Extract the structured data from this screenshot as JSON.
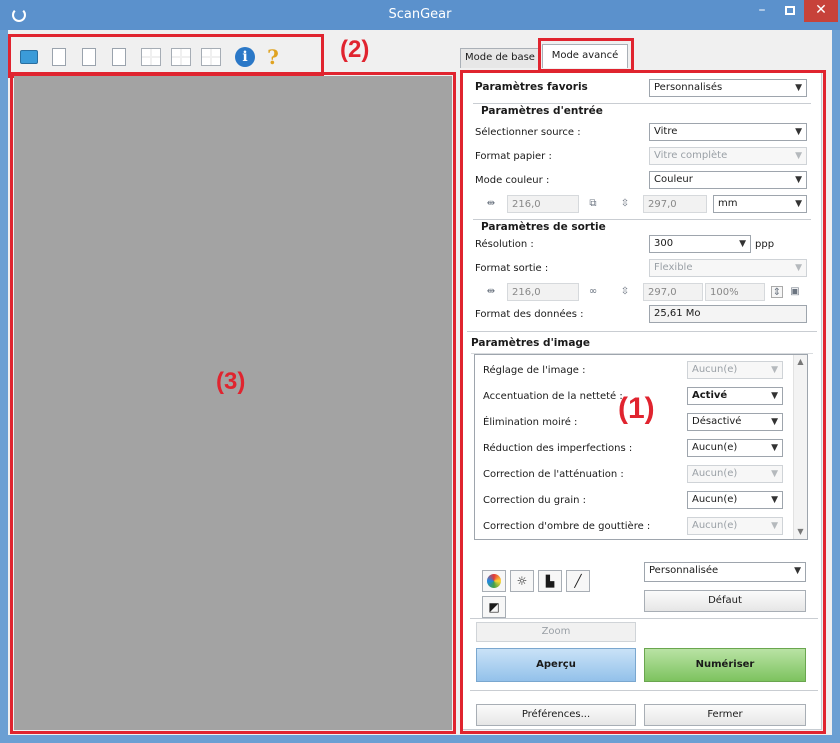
{
  "window": {
    "title": "ScanGear"
  },
  "toolbar": {
    "icons": [
      "scan-icon",
      "blank-page-icon",
      "zoom-image-icon",
      "crop-image-icon",
      "select-all-frames-icon",
      "multi-frame-icon",
      "frames-layout-icon",
      "info-icon",
      "help-icon"
    ]
  },
  "callouts": {
    "one": "(1)",
    "two": "(2)",
    "three": "(3)"
  },
  "tabs": {
    "basic": "Mode de base",
    "advanced": "Mode avancé"
  },
  "favorites": {
    "label": "Paramètres favoris",
    "value": "Personnalisés"
  },
  "input": {
    "title": "Paramètres d'entrée",
    "source_label": "Sélectionner source :",
    "source_value": "Vitre",
    "paper_label": "Format papier :",
    "paper_value": "Vitre complète",
    "color_label": "Mode couleur :",
    "color_value": "Couleur",
    "width": "216,0",
    "height": "297,0",
    "unit": "mm"
  },
  "output": {
    "title": "Paramètres de sortie",
    "res_label": "Résolution :",
    "res_value": "300",
    "res_unit": "ppp",
    "size_label": "Format sortie :",
    "size_value": "Flexible",
    "width": "216,0",
    "height": "297,0",
    "scale": "100%",
    "data_label": "Format des données :",
    "data_value": "25,61 Mo"
  },
  "image": {
    "title": "Paramètres d'image",
    "rows": [
      {
        "label": "Réglage de l'image :",
        "value": "Aucun(e)",
        "enabled": false
      },
      {
        "label": "Accentuation de la netteté :",
        "value": "Activé",
        "enabled": true,
        "bold": true
      },
      {
        "label": "Élimination moiré :",
        "value": "Désactivé",
        "enabled": true
      },
      {
        "label": "Réduction des imperfections :",
        "value": "Aucun(e)",
        "enabled": true
      },
      {
        "label": "Correction de l'atténuation :",
        "value": "Aucun(e)",
        "enabled": false
      },
      {
        "label": "Correction du grain :",
        "value": "Aucun(e)",
        "enabled": true
      },
      {
        "label": "Correction d'ombre de gouttière :",
        "value": "Aucun(e)",
        "enabled": false
      }
    ]
  },
  "adjust": {
    "preset": "Personnalisée",
    "default_label": "Défaut"
  },
  "actions": {
    "zoom": "Zoom",
    "preview": "Aperçu",
    "scan": "Numériser",
    "prefs": "Préférences...",
    "close": "Fermer"
  }
}
